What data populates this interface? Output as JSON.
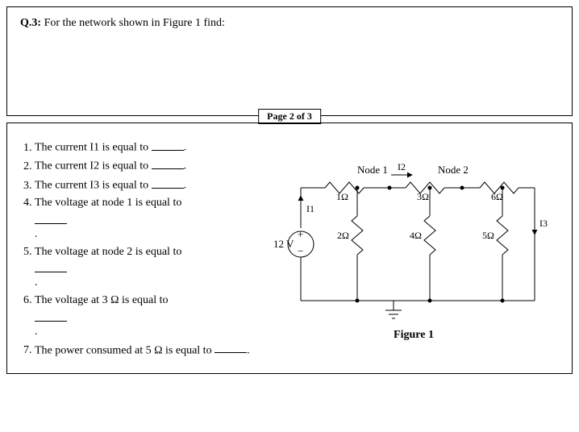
{
  "question_heading_prefix": "Q.3:",
  "question_heading_text": "For the network shown in Figure 1 find:",
  "page_indicator": "Page 2 of 3",
  "items": [
    "The current I1 is equal to ",
    "The current I2 is equal to ",
    "The current I3 is equal to ",
    "The voltage at node 1 is equal to ",
    "The voltage at node 2 is equal to ",
    "The voltage at 3 Ω is equal to ",
    "The power consumed at 5 Ω is equal to "
  ],
  "circuit": {
    "node1_label": "Node 1",
    "node2_label": "Node 2",
    "i1_label": "I1",
    "i2_label": "I2",
    "i3_label": "I3",
    "r_top_left_value": "1Ω",
    "r_top_right_value": "3Ω",
    "r_mid_value": "6Ω",
    "r_left_shunt_value": "2Ω",
    "r_mid_shunt_value": "4Ω",
    "r_right_shunt_value": "5Ω",
    "source_value": "12 V"
  },
  "figure_caption": "Figure 1"
}
